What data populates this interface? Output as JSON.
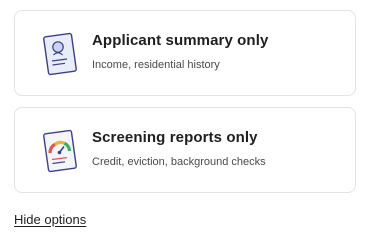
{
  "options": [
    {
      "title": "Applicant summary only",
      "subtitle": "Income, residential history",
      "icon": "applicant-summary-icon"
    },
    {
      "title": "Screening reports only",
      "subtitle": "Credit, eviction, background checks",
      "icon": "screening-report-icon"
    }
  ],
  "hide_link": "Hide options",
  "colors": {
    "card_border": "#e3e3e3",
    "icon_outline": "#3b3f8f",
    "icon_fill": "#e9ecf9",
    "gauge_red": "#e0574f",
    "gauge_yellow": "#f2b233",
    "gauge_green": "#3fae64"
  }
}
